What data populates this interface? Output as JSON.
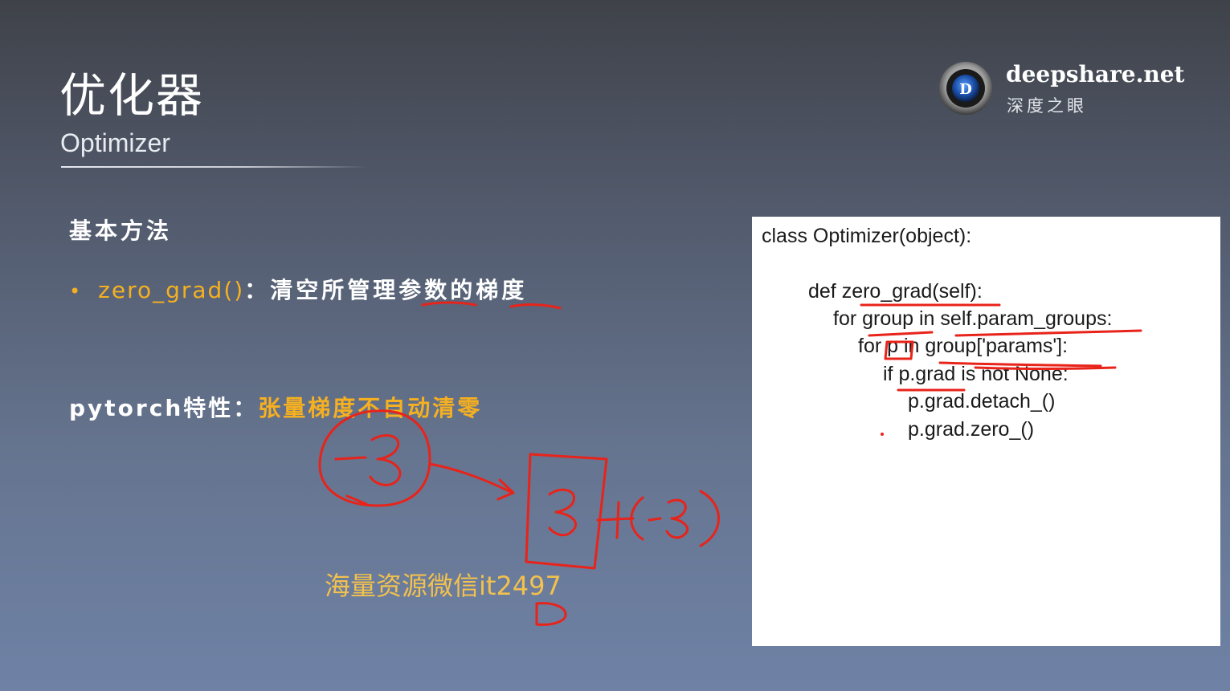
{
  "slide": {
    "title": "优化器",
    "subtitle": "Optimizer",
    "section_heading": "基本方法",
    "bullet": {
      "code_term": "zero_grad()",
      "separator": "：",
      "description": "清空所管理参数的梯度"
    },
    "feature": {
      "label": "pytorch特性",
      "separator": "：",
      "value": "张量梯度不自动清零"
    },
    "watermark": "海量资源微信it2497"
  },
  "logo": {
    "name": "deepshare.net",
    "chinese_name": "深度之眼"
  },
  "code_panel": {
    "lines": [
      "class Optimizer(object):",
      "def zero_grad(self):",
      "for group in self.param_groups:",
      "for p in group['params']:",
      "if p.grad is not None:",
      "p.grad.detach_()",
      "p.grad.zero_()"
    ]
  },
  "colors": {
    "accent": "#f5b021",
    "annotation": "#e8231a",
    "panel_background": "#ffffff"
  }
}
